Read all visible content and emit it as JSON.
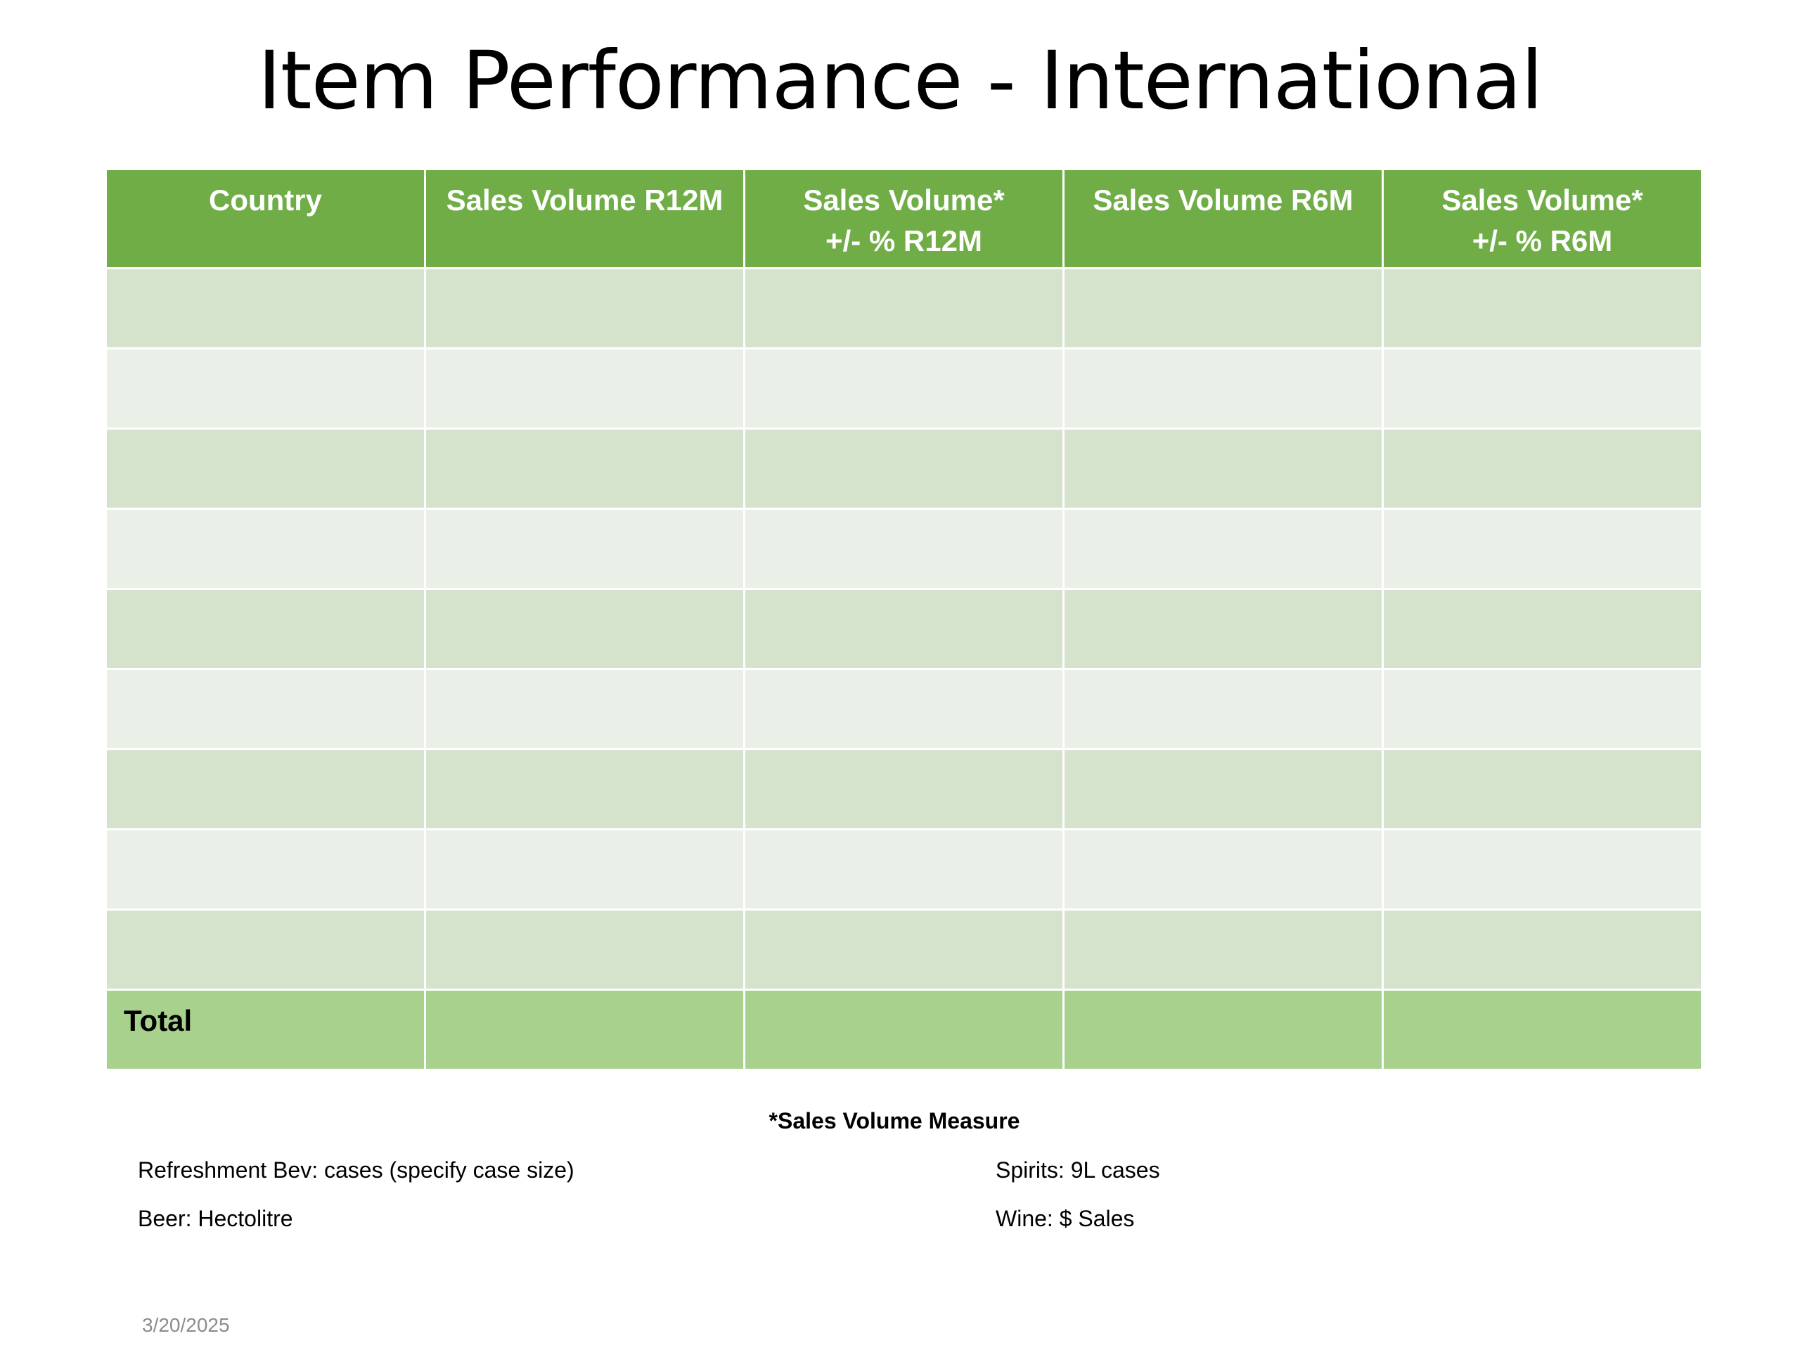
{
  "slide": {
    "title": "Item Performance - International",
    "date": "3/20/2025"
  },
  "table": {
    "headers": [
      "Country",
      "Sales Volume R12M",
      "Sales Volume*\n+/- %  R12M",
      "Sales Volume R6M",
      "Sales Volume*\n+/- %  R6M"
    ],
    "rows": [
      [
        "",
        "",
        "",
        "",
        ""
      ],
      [
        "",
        "",
        "",
        "",
        ""
      ],
      [
        "",
        "",
        "",
        "",
        ""
      ],
      [
        "",
        "",
        "",
        "",
        ""
      ],
      [
        "",
        "",
        "",
        "",
        ""
      ],
      [
        "",
        "",
        "",
        "",
        ""
      ],
      [
        "",
        "",
        "",
        "",
        ""
      ],
      [
        "",
        "",
        "",
        "",
        ""
      ],
      [
        "",
        "",
        "",
        "",
        ""
      ]
    ],
    "total_label": "Total",
    "colors": {
      "header": "#70ad47",
      "row_odd": "#d5e3cd",
      "row_even": "#eaefe8",
      "total": "#a9d18e"
    }
  },
  "notes": {
    "heading": "*Sales Volume Measure",
    "refreshment": "Refreshment Bev: cases (specify case size)",
    "beer": "Beer: Hectolitre",
    "spirits": "Spirits: 9L cases",
    "wine": "Wine: $ Sales"
  }
}
